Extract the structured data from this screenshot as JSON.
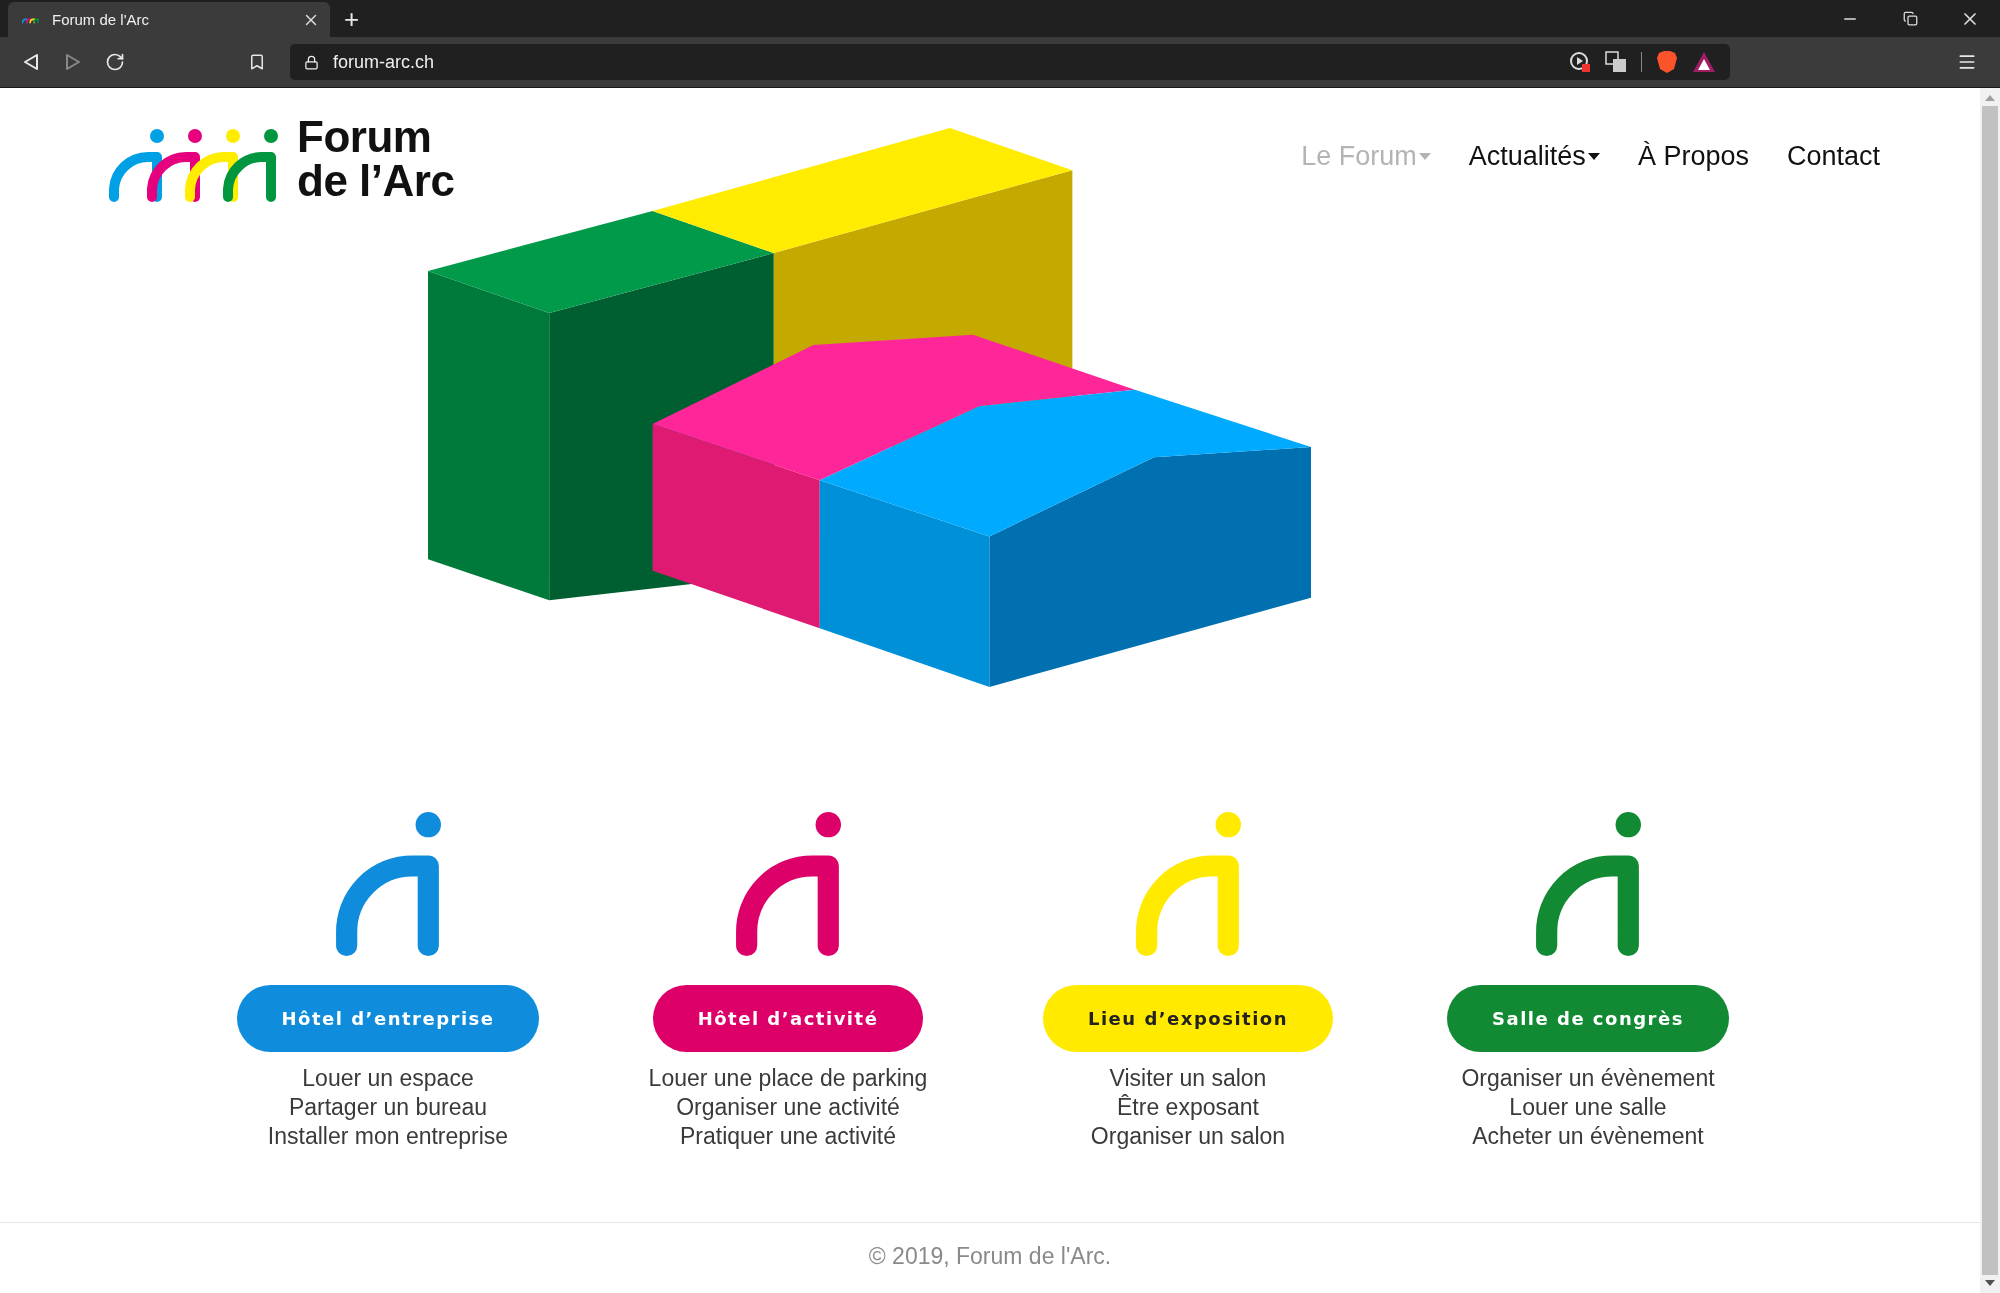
{
  "browser": {
    "tab_title": "Forum de l'Arc",
    "new_tab": "+",
    "url": "forum-arc.ch"
  },
  "logo": {
    "line_1": "Forum",
    "line_2": "de l’Arc"
  },
  "nav": [
    {
      "label": "Le Forum",
      "selected": true,
      "dropdown": true
    },
    {
      "label": "Actualités",
      "selected": false,
      "dropdown": true
    },
    {
      "label": "À Propos",
      "selected": false,
      "dropdown": false
    },
    {
      "label": "Contact",
      "selected": false,
      "dropdown": false
    }
  ],
  "cards": [
    {
      "color": "#0f8ddc",
      "label": "Hôtel d’entreprise",
      "lines": [
        "Louer un espace",
        "Partager un bureau",
        "Installer mon entreprise"
      ]
    },
    {
      "color": "#dc0068",
      "label": "Hôtel d’activité",
      "lines": [
        "Louer une place de parking",
        "Organiser une activité",
        "Pratiquer une activité"
      ]
    },
    {
      "color": "#ffea00",
      "label": "Lieu d’exposition",
      "lines": [
        "Visiter un salon",
        "Être exposant",
        "Organiser un salon"
      ]
    },
    {
      "color": "#128a34",
      "label": "Salle de congrès",
      "lines": [
        "Organiser un évènement",
        "Louer une salle",
        "Acheter un évènement"
      ]
    }
  ],
  "footer": "© 2019, Forum de l'Arc."
}
